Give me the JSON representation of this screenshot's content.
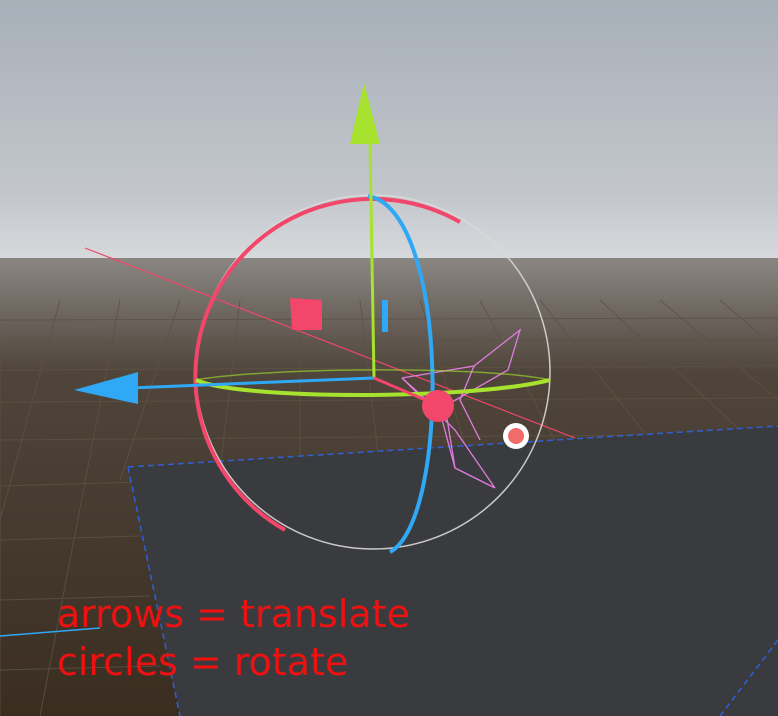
{
  "viewport": {
    "annotations": {
      "line1": "arrows = translate",
      "line2": "circles = rotate"
    }
  },
  "colors": {
    "sky_top": "#a9b1ba",
    "sky_horizon": "#d6d8dc",
    "ground": "#3b2e22",
    "grid_line": "#5a4c3e",
    "floor_plane": "#3a3b3e",
    "floor_plane_edge": "#2f5fd6",
    "axis_x_red": "#f2466a",
    "axis_y_green": "#a6e22e",
    "axis_z_blue": "#2fa8f5",
    "outer_circle": "#d9d9d9",
    "camera_frustum": "#e07ce0",
    "annotation_text": "#ee1111"
  },
  "gizmo": {
    "handles": [
      "translate-x-handle",
      "translate-y-handle",
      "translate-z-handle",
      "rotate-x-ring",
      "rotate-y-ring",
      "rotate-z-ring",
      "rotate-free-ring",
      "plane-handle-xy"
    ]
  },
  "icons": {
    "light_marker": "light-bulb-icon"
  }
}
